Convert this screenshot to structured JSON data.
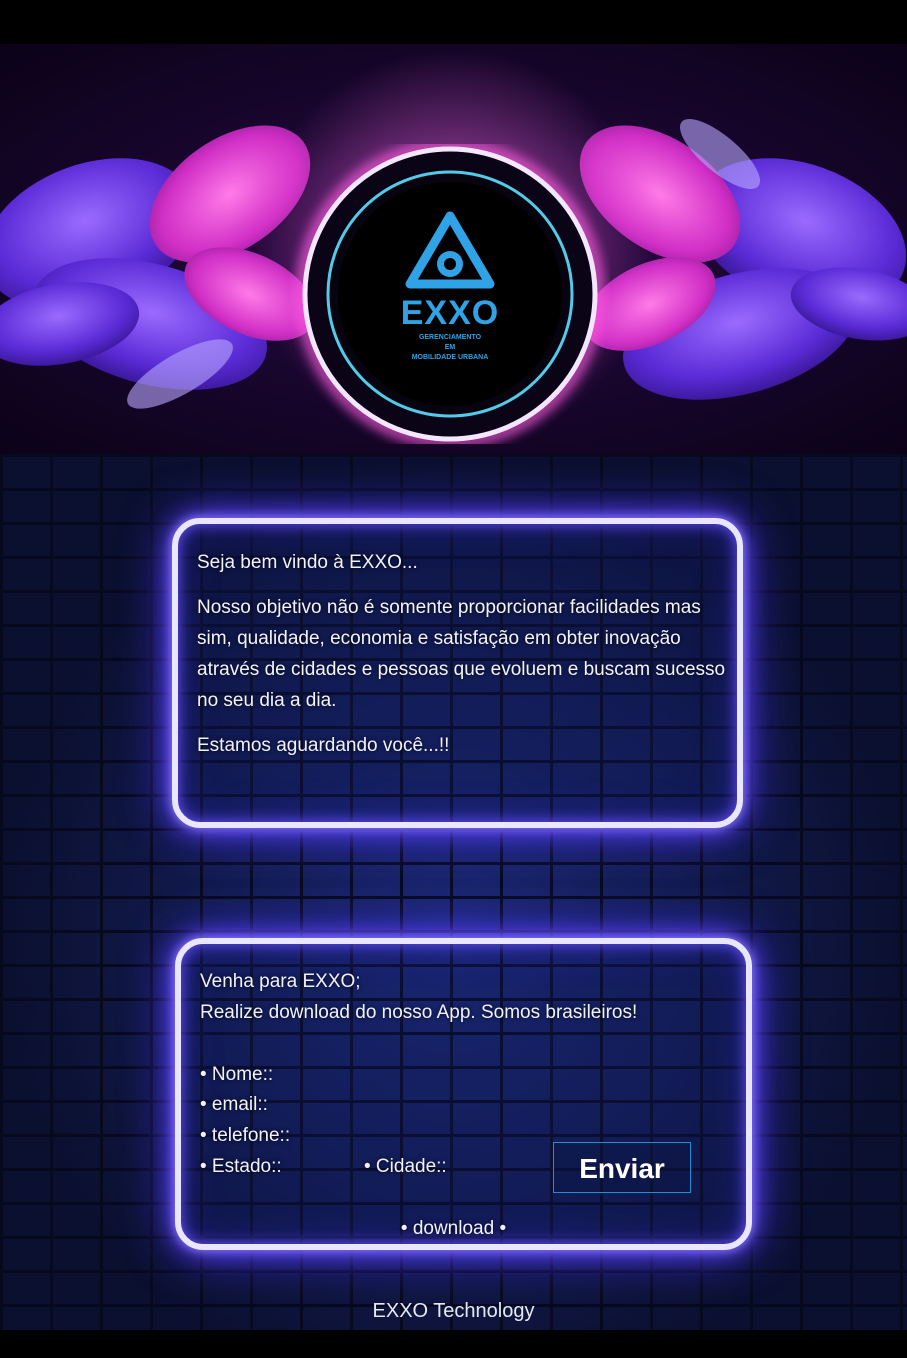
{
  "logo": {
    "wordmark": "EXXO",
    "line1": "GERENCIAMENTO",
    "line2": "EM",
    "line3": "MOBILIDADE URBANA"
  },
  "welcome": {
    "greeting": "Seja bem vindo à EXXO...",
    "paragraph": "Nosso objetivo não é somente proporcionar facilidades mas sim, qualidade, economia e satisfação em obter inovação através de cidades e pessoas que evoluem e buscam sucesso no seu dia a dia.",
    "closing": "Estamos aguardando você...!!"
  },
  "signup": {
    "intro1": "Venha para EXXO;",
    "intro2": "Realize download do nosso App. Somos brasileiros!",
    "fields": {
      "nome": "• Nome::",
      "email": "• email::",
      "telefone": "• telefone::",
      "estado": "• Estado::",
      "cidade": "• Cidade::"
    },
    "submit_label": "Enviar",
    "download_label": "• download •"
  },
  "footer": {
    "text": "EXXO Technology"
  },
  "colors": {
    "neon": "#6b52ff",
    "button_border": "#1d8fd8",
    "logo_blue": "#2fa3e6"
  }
}
